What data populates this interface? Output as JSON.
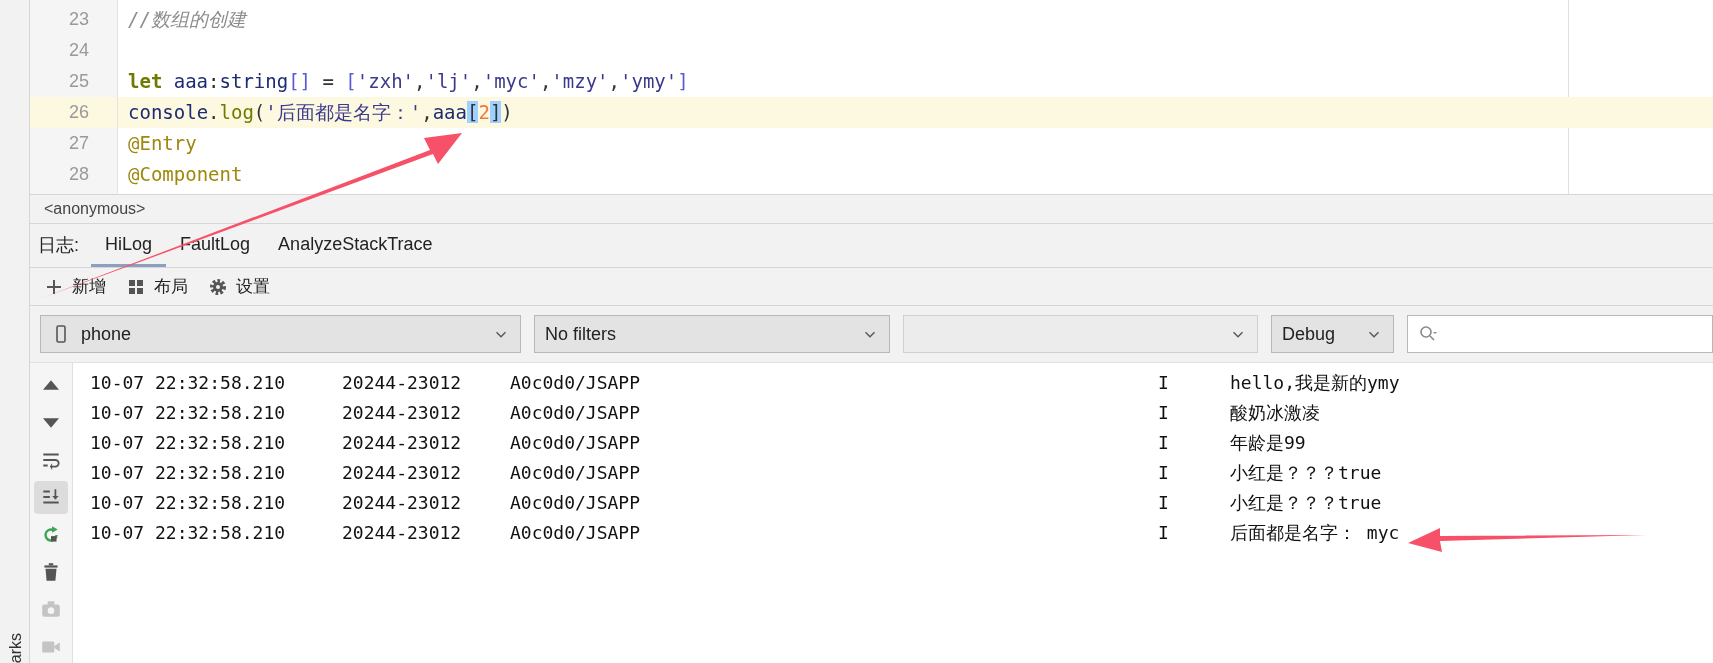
{
  "editor": {
    "lines": [
      {
        "number": "23",
        "current": false,
        "tokens": [
          {
            "kind": "comment",
            "text": "//数组的创建"
          }
        ]
      },
      {
        "number": "24",
        "current": false
      },
      {
        "number": "25",
        "current": false,
        "tokens": [
          {
            "kind": "keyword",
            "text": "let"
          },
          {
            "kind": "ident",
            "text": "aaa"
          },
          {
            "kind": "plain",
            "text": ":"
          },
          {
            "kind": "ident",
            "text": "string"
          },
          {
            "kind": "bracket",
            "text": "[]"
          },
          {
            "kind": "plain",
            "text": " = "
          },
          {
            "kind": "bracket",
            "text": "["
          },
          {
            "kind": "string",
            "text": "'zxh'"
          },
          {
            "kind": "plain",
            "text": ","
          },
          {
            "kind": "string",
            "text": "'lj'"
          },
          {
            "kind": "plain",
            "text": ","
          },
          {
            "kind": "string",
            "text": "'myc'"
          },
          {
            "kind": "plain",
            "text": ","
          },
          {
            "kind": "string",
            "text": "'mzy'"
          },
          {
            "kind": "plain",
            "text": ","
          },
          {
            "kind": "string",
            "text": "'ymy'"
          },
          {
            "kind": "bracket",
            "text": "]"
          }
        ]
      },
      {
        "number": "26",
        "current": true,
        "tokens": [
          {
            "kind": "ident",
            "text": "console"
          },
          {
            "kind": "plain",
            "text": "."
          },
          {
            "kind": "method",
            "text": "log"
          },
          {
            "kind": "plain",
            "text": "("
          },
          {
            "kind": "string",
            "text": "'后面都是名字：'"
          },
          {
            "kind": "plain",
            "text": ","
          },
          {
            "kind": "ident",
            "text": "aaa"
          },
          {
            "kind": "match",
            "text": "["
          },
          {
            "kind": "number",
            "text": "2"
          },
          {
            "kind": "match",
            "text": "]"
          },
          {
            "kind": "plain",
            "text": ")"
          }
        ]
      },
      {
        "number": "27",
        "current": false,
        "tokens": [
          {
            "kind": "annotation",
            "text": "@Entry"
          }
        ]
      },
      {
        "number": "28",
        "current": false,
        "tokens": [
          {
            "kind": "annotation",
            "text": "@Component"
          }
        ]
      }
    ]
  },
  "panel": {
    "title": "<anonymous>",
    "tabs_label": "日志:",
    "tabs": [
      {
        "label": "HiLog",
        "selected": true
      },
      {
        "label": "FaultLog",
        "selected": false
      },
      {
        "label": "AnalyzeStackTrace",
        "selected": false
      }
    ],
    "toolbar": [
      {
        "kind": "add",
        "label": "新增"
      },
      {
        "kind": "layout",
        "label": "布局"
      },
      {
        "kind": "settings",
        "label": "设置"
      }
    ],
    "filters": {
      "device": "phone",
      "filter": "No filters",
      "level": "Debug"
    },
    "side_tools": [
      {
        "kind": "up",
        "selected": false,
        "disabled": false
      },
      {
        "kind": "down",
        "selected": false,
        "disabled": false
      },
      {
        "kind": "wrap",
        "selected": false,
        "disabled": false
      },
      {
        "kind": "scroll-end",
        "selected": true,
        "disabled": false
      },
      {
        "kind": "restart",
        "selected": false,
        "disabled": false
      },
      {
        "kind": "trash",
        "selected": false,
        "disabled": false
      },
      {
        "kind": "camera",
        "selected": false,
        "disabled": true
      },
      {
        "kind": "video",
        "selected": false,
        "disabled": true
      }
    ],
    "logs": [
      {
        "time": "10-07 22:32:58.210",
        "pid": "20244-23012",
        "tag": "A0c0d0/JSAPP",
        "level": "I",
        "message": "hello,我是新的ymy"
      },
      {
        "time": "10-07 22:32:58.210",
        "pid": "20244-23012",
        "tag": "A0c0d0/JSAPP",
        "level": "I",
        "message": "酸奶冰激凌"
      },
      {
        "time": "10-07 22:32:58.210",
        "pid": "20244-23012",
        "tag": "A0c0d0/JSAPP",
        "level": "I",
        "message": "年龄是99"
      },
      {
        "time": "10-07 22:32:58.210",
        "pid": "20244-23012",
        "tag": "A0c0d0/JSAPP",
        "level": "I",
        "message": "小红是？？？true"
      },
      {
        "time": "10-07 22:32:58.210",
        "pid": "20244-23012",
        "tag": "A0c0d0/JSAPP",
        "level": "I",
        "message": "小红是？？？true"
      },
      {
        "time": "10-07 22:32:58.210",
        "pid": "20244-23012",
        "tag": "A0c0d0/JSAPP",
        "level": "I",
        "message": "后面都是名字： myc"
      }
    ]
  },
  "left_strip": {
    "label": "arks"
  }
}
